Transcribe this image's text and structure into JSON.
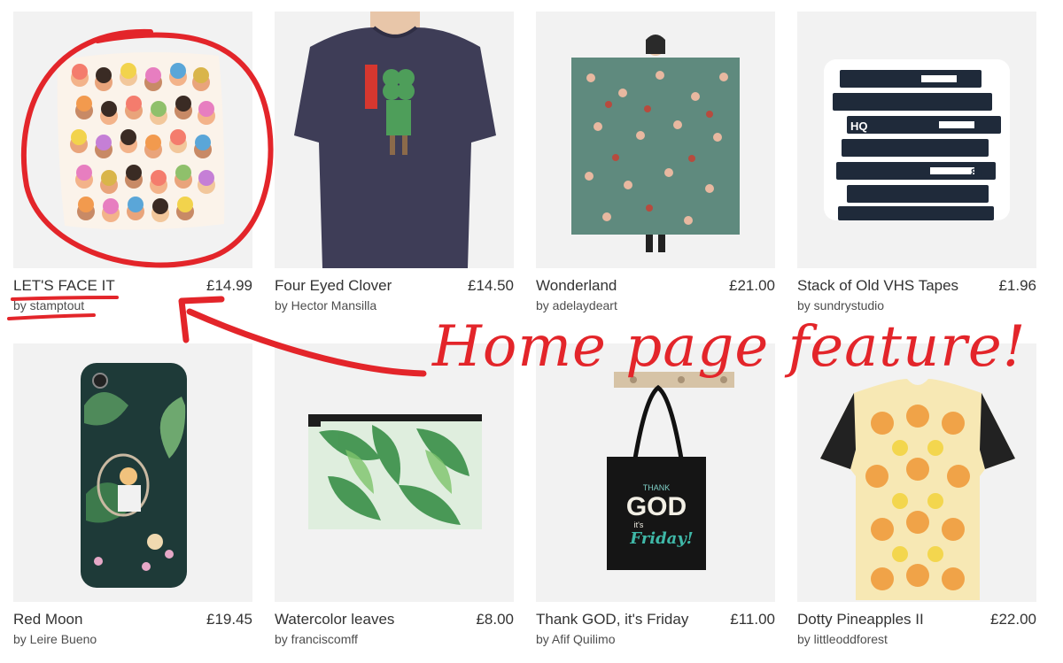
{
  "products": [
    {
      "title": "LET'S FACE IT",
      "price": "£14.99",
      "artist": "by stamptout",
      "product_type": "throw-pillow"
    },
    {
      "title": "Four Eyed Clover",
      "price": "£14.50",
      "artist": "by Hector Mansilla",
      "product_type": "t-shirt"
    },
    {
      "title": "Wonderland",
      "price": "£21.00",
      "artist": "by adelaydeart",
      "product_type": "scarf"
    },
    {
      "title": "Stack of Old VHS Tapes",
      "price": "£1.96",
      "artist": "by sundrystudio",
      "product_type": "sticker"
    },
    {
      "title": "Red Moon",
      "price": "£19.45",
      "artist": "by Leire Bueno",
      "product_type": "phone-case"
    },
    {
      "title": "Watercolor leaves",
      "price": "£8.00",
      "artist": "by franciscomff",
      "product_type": "zipper-pouch"
    },
    {
      "title": "Thank GOD, it's Friday",
      "price": "£11.00",
      "artist": "by Afif Quilimo",
      "product_type": "tote-bag"
    },
    {
      "title": "Dotty Pineapples II",
      "price": "£22.00",
      "artist": "by littleoddforest",
      "product_type": "graphic-t-shirt"
    }
  ],
  "annotation": {
    "text": "Home page feature!",
    "color": "#e3252a"
  },
  "artwork_text": {
    "tote_line1": "THANK",
    "tote_line2": "GOD",
    "tote_line3": "it's",
    "tote_line4": "Friday!",
    "vhs_label": "HQ",
    "vhs_number": "80"
  }
}
